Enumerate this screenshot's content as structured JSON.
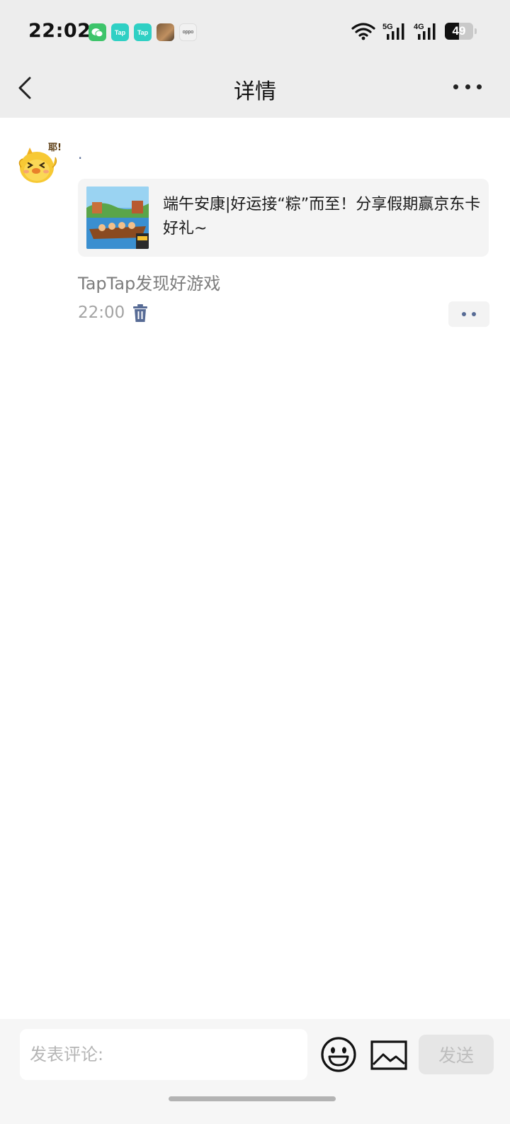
{
  "status_bar": {
    "time": "22:02",
    "app_icons": [
      "wechat-icon",
      "taptap-icon",
      "taptap-icon",
      "game-icon",
      "oppo-icon"
    ],
    "app_labels": {
      "tap": "Tap",
      "oppo": "oppo"
    },
    "network_5g": "5G",
    "network_4g": "4G",
    "battery_level": "49",
    "battery_fraction": 0.49
  },
  "navbar": {
    "title": "详情"
  },
  "post": {
    "author": ".",
    "avatar_badge": "耶!",
    "link_card": {
      "title": "端午安康|好运接“粽”而至！分享假期赢京东卡好礼~"
    },
    "source": "TapTap发现好游戏",
    "time": "22:00"
  },
  "comment_bar": {
    "placeholder": "发表评论:",
    "send_label": "发送"
  },
  "colors": {
    "bar_background": "#ededed",
    "link_blue": "#576b95",
    "muted_text": "#a3a3a3"
  }
}
